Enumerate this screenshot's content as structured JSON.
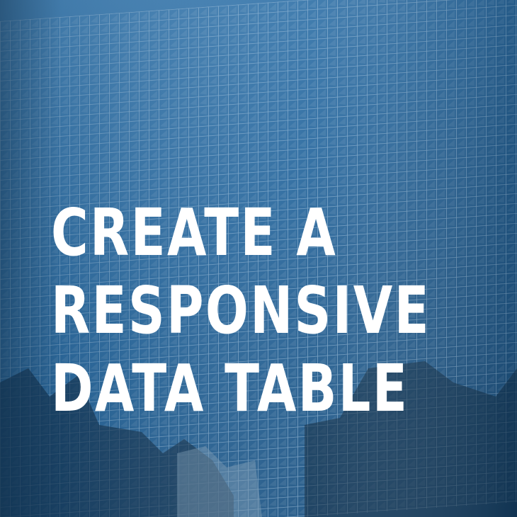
{
  "headline": {
    "line1": "CREATE A",
    "line2": "RESPONSIVE",
    "line3": "DATA TABLE"
  },
  "colors": {
    "text": "#ffffff",
    "glass_light": "#6fa6d1",
    "glass_mid": "#2f6fa3",
    "glass_dark": "#153c5e",
    "mullion": "#a9c6de"
  }
}
